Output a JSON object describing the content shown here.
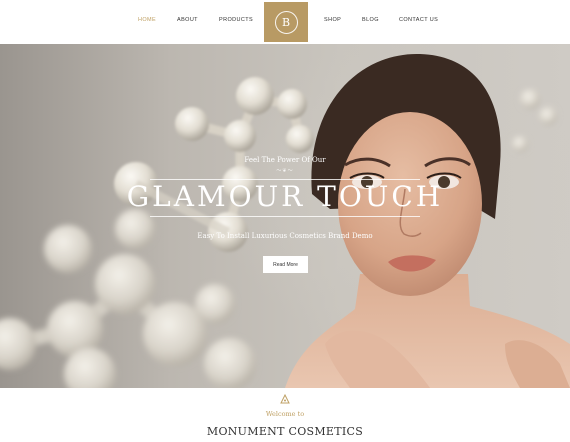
{
  "nav": {
    "items": [
      {
        "label": "HOME",
        "active": true
      },
      {
        "label": "ABOUT",
        "active": false
      },
      {
        "label": "PRODUCTS",
        "active": false
      },
      {
        "label": "SHOP",
        "active": false
      },
      {
        "label": "BLOG",
        "active": false
      },
      {
        "label": "CONTACT US",
        "active": false
      }
    ],
    "logo_letter": "B"
  },
  "hero": {
    "tagline": "Feel The Power Of Our",
    "title": "GLAMOUR TOUCH",
    "subtitle": "Easy To Install Luxurious Cosmetics Brand Demo",
    "button_label": "Read More"
  },
  "welcome": {
    "icon": "triangle-ornament-icon",
    "text": "Welcome to",
    "title": "MONUMENT COSMETICS"
  },
  "colors": {
    "accent": "#bfa064",
    "logo_bg": "#b89a64",
    "text_dark": "#333333",
    "white": "#ffffff"
  }
}
